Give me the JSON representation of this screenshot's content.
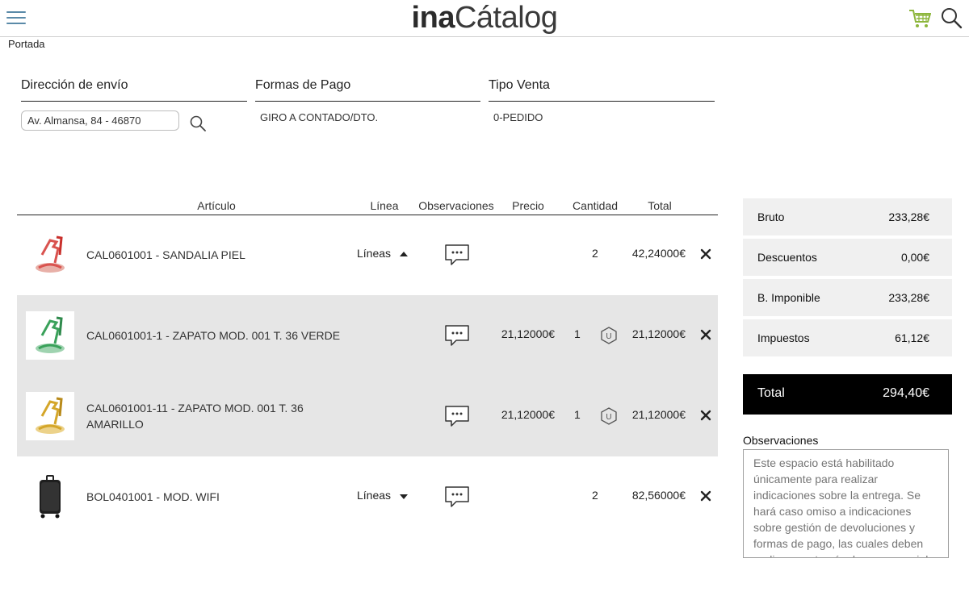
{
  "header": {
    "logo_part1": "ina",
    "logo_part2": "Cátalog",
    "accent_color": "#8db63c"
  },
  "breadcrumb": "Portada",
  "fields": {
    "address_label": "Dirección de envío",
    "address_value": "Av. Almansa, 84 - 46870",
    "payment_label": "Formas de Pago",
    "payment_value": "GIRO A CONTADO/DTO.",
    "sale_type_label": "Tipo Venta",
    "sale_type_value": "0-PEDIDO"
  },
  "table": {
    "headers": {
      "articulo": "Artículo",
      "linea": "Línea",
      "observaciones": "Observaciones",
      "precio": "Precio",
      "cantidad": "Cantidad",
      "total": "Total"
    },
    "rows": [
      {
        "desc": "CAL0601001 - SANDALIA PIEL",
        "linea": "Líneas",
        "precio": "",
        "cantidad": "2",
        "total": "42,24000€"
      },
      {
        "desc": "CAL0601001-1 - ZAPATO MOD. 001 T. 36 VERDE",
        "linea": "",
        "precio": "21,12000€",
        "cantidad": "1",
        "unit": "U",
        "total": "21,12000€"
      },
      {
        "desc": "CAL0601001-11 - ZAPATO MOD. 001 T. 36 AMARILLO",
        "linea": "",
        "precio": "21,12000€",
        "cantidad": "1",
        "unit": "U",
        "total": "21,12000€"
      },
      {
        "desc": "BOL0401001 - MOD. WIFI",
        "linea": "Líneas",
        "precio": "",
        "cantidad": "2",
        "total": "82,56000€"
      }
    ]
  },
  "summary": {
    "bruto_label": "Bruto",
    "bruto_value": "233,28€",
    "descuentos_label": "Descuentos",
    "descuentos_value": "0,00€",
    "imponible_label": "B. Imponible",
    "imponible_value": "233,28€",
    "impuestos_label": "Impuestos",
    "impuestos_value": "61,12€",
    "total_label": "Total",
    "total_value": "294,40€"
  },
  "observaciones": {
    "label": "Observaciones",
    "placeholder": "Este espacio está habilitado únicamente para realizar indicaciones sobre la entrega. Se hará caso omiso a indicaciones sobre gestión de devoluciones y formas de pago, las cuales deben realizarse a través de su comercial."
  }
}
